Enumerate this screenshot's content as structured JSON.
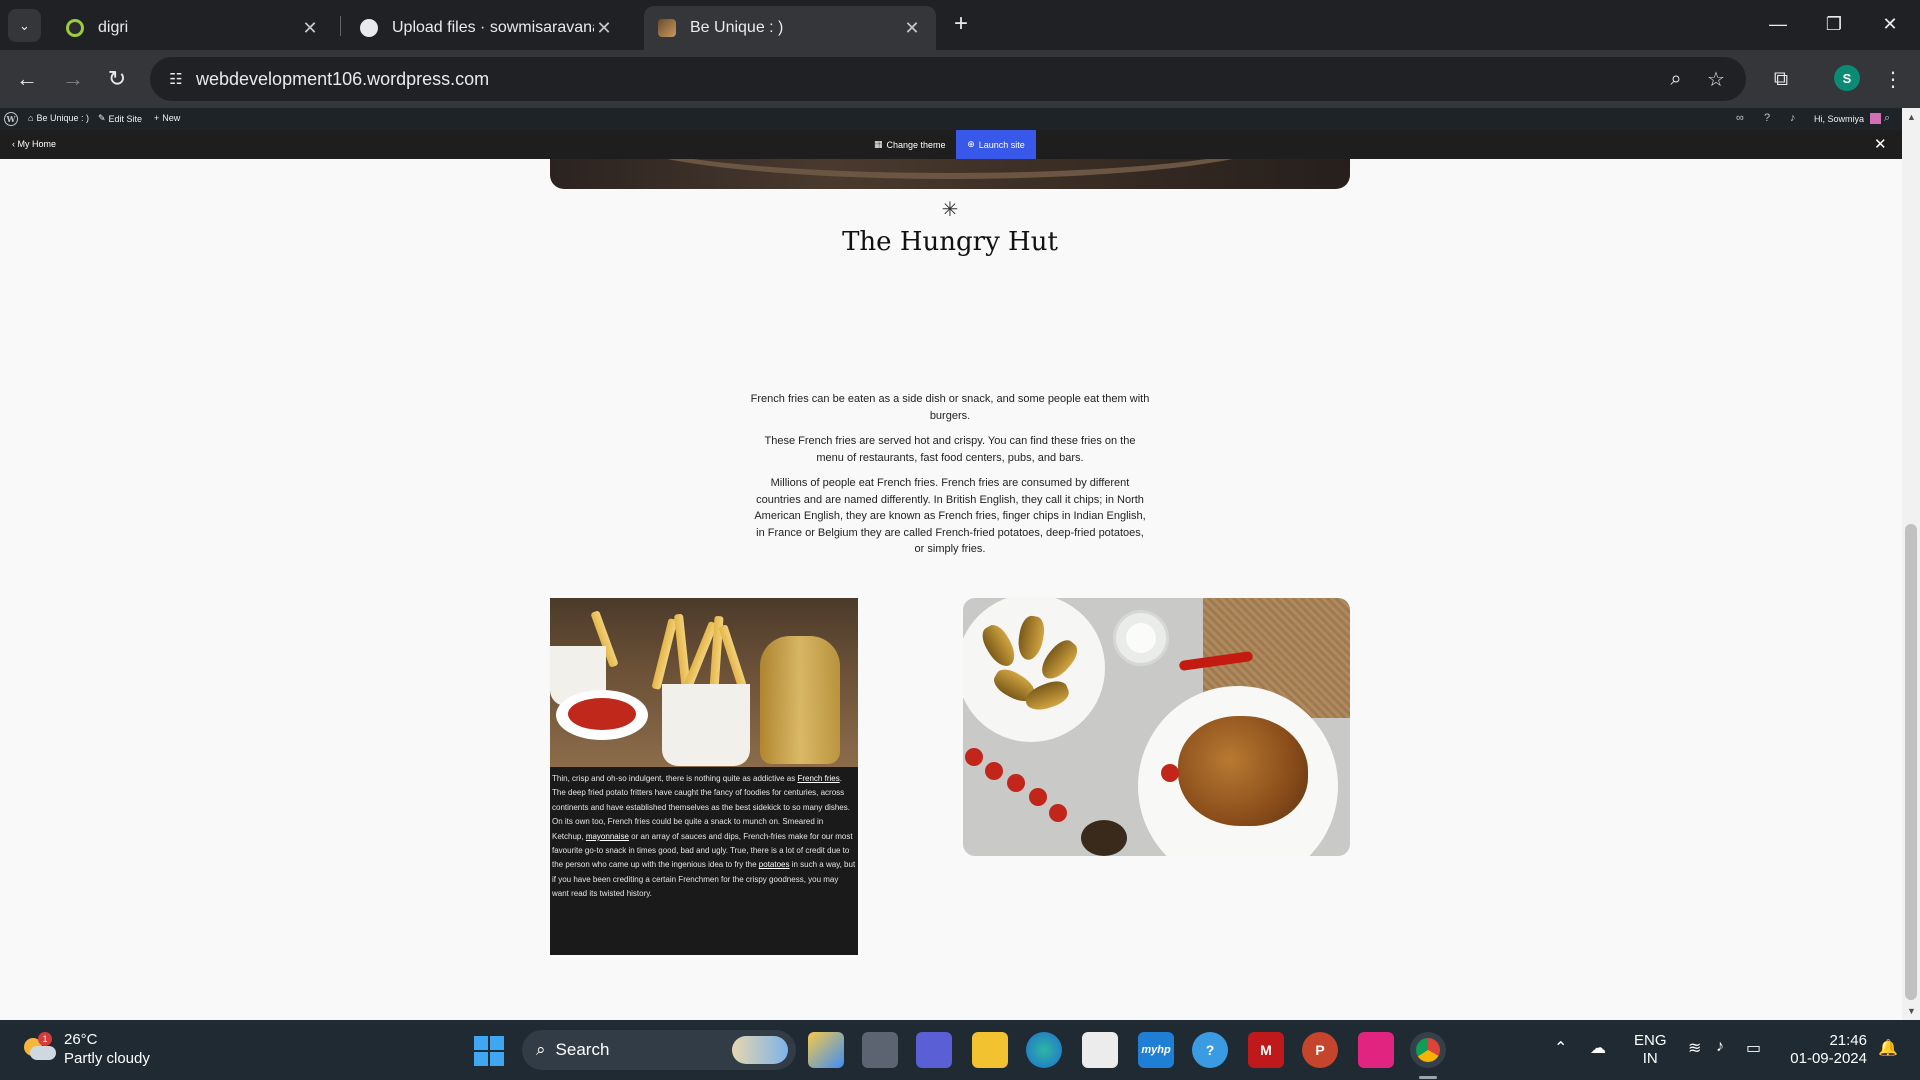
{
  "browser": {
    "tabs": [
      {
        "title": "digri",
        "active": false
      },
      {
        "title": "Upload files · sowmisaravana/sc",
        "active": false
      },
      {
        "title": "Be Unique : )",
        "active": true
      }
    ],
    "url": "webdevelopment106.wordpress.com",
    "profile_initial": "S"
  },
  "wp_admin_bar": {
    "site_name": "Be Unique : )",
    "edit_site": "Edit Site",
    "new": "New",
    "greeting": "Hi, Sowmiya"
  },
  "editor_strip": {
    "my_home": "My Home",
    "change_theme": "Change theme",
    "launch_site": "Launch site"
  },
  "page": {
    "asterisk": "✳",
    "site_title": "The Hungry Hut",
    "paragraphs": [
      "French fries can be eaten as a side dish or snack, and some people eat them with burgers.",
      "These French fries are served hot and crispy. You can find these fries on the menu of restaurants, fast food centers, pubs, and bars.",
      "Millions of people eat French fries. French fries are consumed by different countries and are named differently. In British English, they call it chips; in North American English, they are known as French fries, finger chips in Indian English, in France or Belgium they are called French-fried potatoes, deep-fried potatoes, or simply fries."
    ],
    "card_text": {
      "t1": "Thin, crisp and oh-so indulgent, there is nothing quite as addictive as ",
      "link1": "French fries",
      "t2": ". The deep fried potato fritters have caught the fancy of foodies for centuries, across continents and have established themselves as the best sidekick to so many dishes. On its own too, French fries could be quite a snack to munch on. Smeared in Ketchup, ",
      "link2": "mayonnaise",
      "t3": " or an array of sauces and dips, French-fries make for our most favourite go-to snack in times good, bad and ugly. True, there is a lot of credit due to the person who came up with the ingenious idea to fry the ",
      "link3": "potatoes",
      "t4": " in such a way, but if you have been crediting a certain Frenchmen for the crispy goodness, you may want read its twisted history."
    }
  },
  "taskbar": {
    "temperature": "26°C",
    "weather": "Partly cloudy",
    "weather_badge": "1",
    "search_label": "Search",
    "lang_line1": "ENG",
    "lang_line2": "IN",
    "time": "21:46",
    "date": "01-09-2024"
  }
}
